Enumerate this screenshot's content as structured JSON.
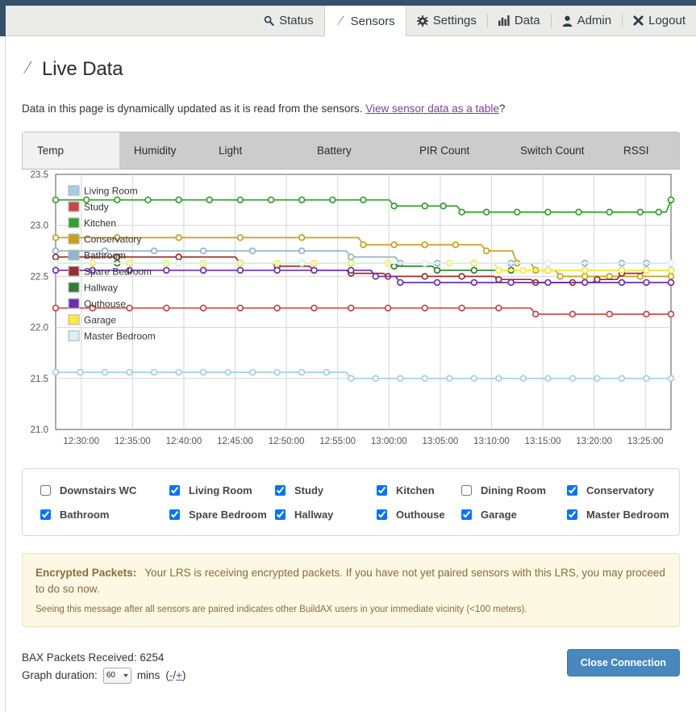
{
  "nav": {
    "items": [
      {
        "label": "Status",
        "icon": "search-icon",
        "active": false
      },
      {
        "label": "Sensors",
        "icon": "bolt-icon",
        "active": true
      },
      {
        "label": "Settings",
        "icon": "gear-icon",
        "active": false
      },
      {
        "label": "Data",
        "icon": "bar-chart-icon",
        "active": false
      },
      {
        "label": "Admin",
        "icon": "user-icon",
        "active": false
      },
      {
        "label": "Logout",
        "icon": "close-icon",
        "active": false
      }
    ]
  },
  "page": {
    "title": "Live Data",
    "title_icon": "bolt-icon",
    "intro_before": "Data in this page is dynamically updated as it is read from the sensors. ",
    "intro_link": "View sensor data as a table",
    "intro_after": "?"
  },
  "metric_tabs": [
    {
      "label": "Temp",
      "active": true
    },
    {
      "label": "Humidity",
      "active": false
    },
    {
      "label": "Light",
      "active": false
    },
    {
      "label": "Battery",
      "active": false
    },
    {
      "label": "PIR Count",
      "active": false
    },
    {
      "label": "Switch Count",
      "active": false
    },
    {
      "label": "RSSI",
      "active": false
    }
  ],
  "chart_data": {
    "type": "line",
    "title": "",
    "xlabel": "",
    "ylabel": "",
    "ylim": [
      21.0,
      23.5
    ],
    "yticks": [
      "21.0",
      "21.5",
      "22.0",
      "22.5",
      "23.0",
      "23.5"
    ],
    "ytick_values": [
      21.0,
      21.5,
      22.0,
      22.5,
      23.0,
      23.5
    ],
    "xticks": [
      "12:30:00",
      "12:35:00",
      "12:40:00",
      "12:45:00",
      "12:50:00",
      "12:55:00",
      "13:00:00",
      "13:05:00",
      "13:10:00",
      "13:15:00",
      "13:20:00",
      "13:25:00"
    ],
    "xlim": [
      "12:28:00",
      "13:27:00"
    ],
    "grid": true,
    "legend_position": "top-left-inside",
    "markers": "open-circle",
    "series": [
      {
        "name": "Living Room",
        "color": "#a6cee3",
        "x": [
          0,
          4,
          8,
          12,
          16,
          20,
          24,
          28,
          32,
          36,
          40,
          44,
          48,
          52,
          56,
          60,
          64,
          68,
          72,
          76,
          80,
          84,
          88,
          92,
          96,
          100
        ],
        "values": [
          21.56,
          21.56,
          21.56,
          21.56,
          21.56,
          21.56,
          21.56,
          21.56,
          21.56,
          21.56,
          21.56,
          21.56,
          21.5,
          21.5,
          21.5,
          21.5,
          21.5,
          21.5,
          21.5,
          21.5,
          21.5,
          21.5,
          21.5,
          21.5,
          21.5,
          21.5
        ]
      },
      {
        "name": "Study",
        "color": "#cc4444",
        "x": [
          0,
          6,
          12,
          18,
          24,
          30,
          36,
          42,
          48,
          54,
          60,
          66,
          72,
          78,
          84,
          90,
          96,
          100
        ],
        "values": [
          22.19,
          22.19,
          22.19,
          22.19,
          22.19,
          22.19,
          22.19,
          22.19,
          22.19,
          22.19,
          22.19,
          22.19,
          22.19,
          22.13,
          22.13,
          22.13,
          22.13,
          22.13
        ]
      },
      {
        "name": "Kitchen",
        "color": "#33a02c",
        "x": [
          0,
          5,
          10,
          15,
          20,
          25,
          30,
          35,
          40,
          45,
          50,
          55,
          60,
          63,
          66,
          70,
          75,
          80,
          85,
          90,
          95,
          98,
          100
        ],
        "values": [
          23.25,
          23.25,
          23.25,
          23.25,
          23.25,
          23.25,
          23.25,
          23.25,
          23.25,
          23.25,
          23.25,
          23.19,
          23.19,
          23.19,
          23.13,
          23.13,
          23.13,
          23.13,
          23.13,
          23.13,
          23.13,
          23.13,
          23.25
        ]
      },
      {
        "name": "Conservatory",
        "color": "#c8a11a",
        "x": [
          0,
          10,
          20,
          30,
          40,
          50,
          55,
          60,
          65,
          70,
          75,
          78,
          82,
          86,
          90,
          95,
          100
        ],
        "values": [
          22.88,
          22.88,
          22.88,
          22.88,
          22.88,
          22.81,
          22.81,
          22.81,
          22.81,
          22.75,
          22.63,
          22.56,
          22.5,
          22.5,
          22.5,
          22.5,
          22.5
        ]
      },
      {
        "name": "Bathroom",
        "color": "#8fb4cc",
        "x": [
          0,
          8,
          16,
          24,
          32,
          40,
          48,
          56,
          62,
          68,
          74,
          80,
          86,
          92,
          96,
          100
        ],
        "values": [
          22.75,
          22.75,
          22.75,
          22.75,
          22.75,
          22.75,
          22.69,
          22.63,
          22.63,
          22.63,
          22.63,
          22.63,
          22.63,
          22.63,
          22.63,
          22.63
        ]
      },
      {
        "name": "Spare Bedroom",
        "color": "#9b2d2d",
        "x": [
          0,
          10,
          20,
          30,
          36,
          42,
          48,
          54,
          60,
          66,
          72,
          78,
          84,
          88,
          92,
          96,
          100
        ],
        "values": [
          22.69,
          22.69,
          22.69,
          22.63,
          22.6,
          22.56,
          22.53,
          22.5,
          22.5,
          22.5,
          22.47,
          22.44,
          22.44,
          22.47,
          22.53,
          22.56,
          22.56
        ]
      },
      {
        "name": "Hallway",
        "color": "#2e7d32",
        "x": [
          0,
          10,
          20,
          30,
          40,
          48,
          55,
          62,
          68,
          74,
          80,
          86,
          92,
          96,
          100
        ],
        "values": [
          22.63,
          22.63,
          22.63,
          22.63,
          22.63,
          22.63,
          22.6,
          22.56,
          22.56,
          22.56,
          22.56,
          22.56,
          22.56,
          22.56,
          22.56
        ]
      },
      {
        "name": "Outhouse",
        "color": "#6a2fb5",
        "x": [
          0,
          6,
          12,
          18,
          24,
          30,
          36,
          42,
          48,
          52,
          56,
          62,
          68,
          74,
          80,
          86,
          92,
          96,
          100
        ],
        "values": [
          22.56,
          22.56,
          22.56,
          22.56,
          22.56,
          22.56,
          22.56,
          22.56,
          22.56,
          22.5,
          22.44,
          22.44,
          22.44,
          22.44,
          22.44,
          22.44,
          22.44,
          22.44,
          22.44
        ]
      },
      {
        "name": "Garage",
        "color": "#ffe93b",
        "x": [
          0,
          6,
          12,
          18,
          24,
          30,
          36,
          42,
          48,
          54,
          60,
          64,
          68,
          72,
          76,
          80,
          86,
          92,
          96,
          100
        ],
        "values": [
          22.63,
          22.63,
          22.63,
          22.63,
          22.63,
          22.63,
          22.63,
          22.63,
          22.63,
          22.63,
          22.63,
          22.63,
          22.63,
          22.56,
          22.56,
          22.56,
          22.56,
          22.56,
          22.56,
          22.56
        ]
      },
      {
        "name": "Master Bedroom",
        "color": "#d8f3f7",
        "x": [
          0,
          20,
          40,
          60,
          80,
          100
        ],
        "values": [
          22.63,
          22.63,
          22.63,
          22.63,
          22.63,
          22.63
        ]
      }
    ]
  },
  "sensor_checkboxes": [
    {
      "label": "Downstairs WC",
      "checked": false
    },
    {
      "label": "Living Room",
      "checked": true
    },
    {
      "label": "Study",
      "checked": true
    },
    {
      "label": "Kitchen",
      "checked": true
    },
    {
      "label": "Dining Room",
      "checked": false
    },
    {
      "label": "Conservatory",
      "checked": true
    },
    {
      "label": "Bathroom",
      "checked": true
    },
    {
      "label": "Spare Bedroom",
      "checked": true
    },
    {
      "label": "Hallway",
      "checked": true
    },
    {
      "label": "Outhouse",
      "checked": true
    },
    {
      "label": "Garage",
      "checked": true
    },
    {
      "label": "Master Bedroom",
      "checked": true
    }
  ],
  "alert": {
    "heading": "Encrypted Packets:",
    "body": "Your LRS is receiving encrypted packets. If you have not yet paired sensors with this LRS, you may proceed to do so now.",
    "note": "Seeing this message after all sensors are paired indicates other BuildAX users in your immediate vicinity (<100 meters)."
  },
  "footer": {
    "packets_label": "BAX Packets Received: 6254",
    "duration_label": "Graph duration:",
    "duration_value": "60",
    "duration_unit": "mins",
    "dur_open": "(",
    "dur_minus": "-",
    "dur_slash": "/",
    "dur_plus": "+",
    "dur_close": ")",
    "close_button": "Close Connection"
  },
  "colors": {
    "navy": "#35506b",
    "primary_button": "#4a87bf",
    "link": "#7b3fa0",
    "alert_bg": "#fcf8e3",
    "alert_text": "#8a6d3b"
  }
}
